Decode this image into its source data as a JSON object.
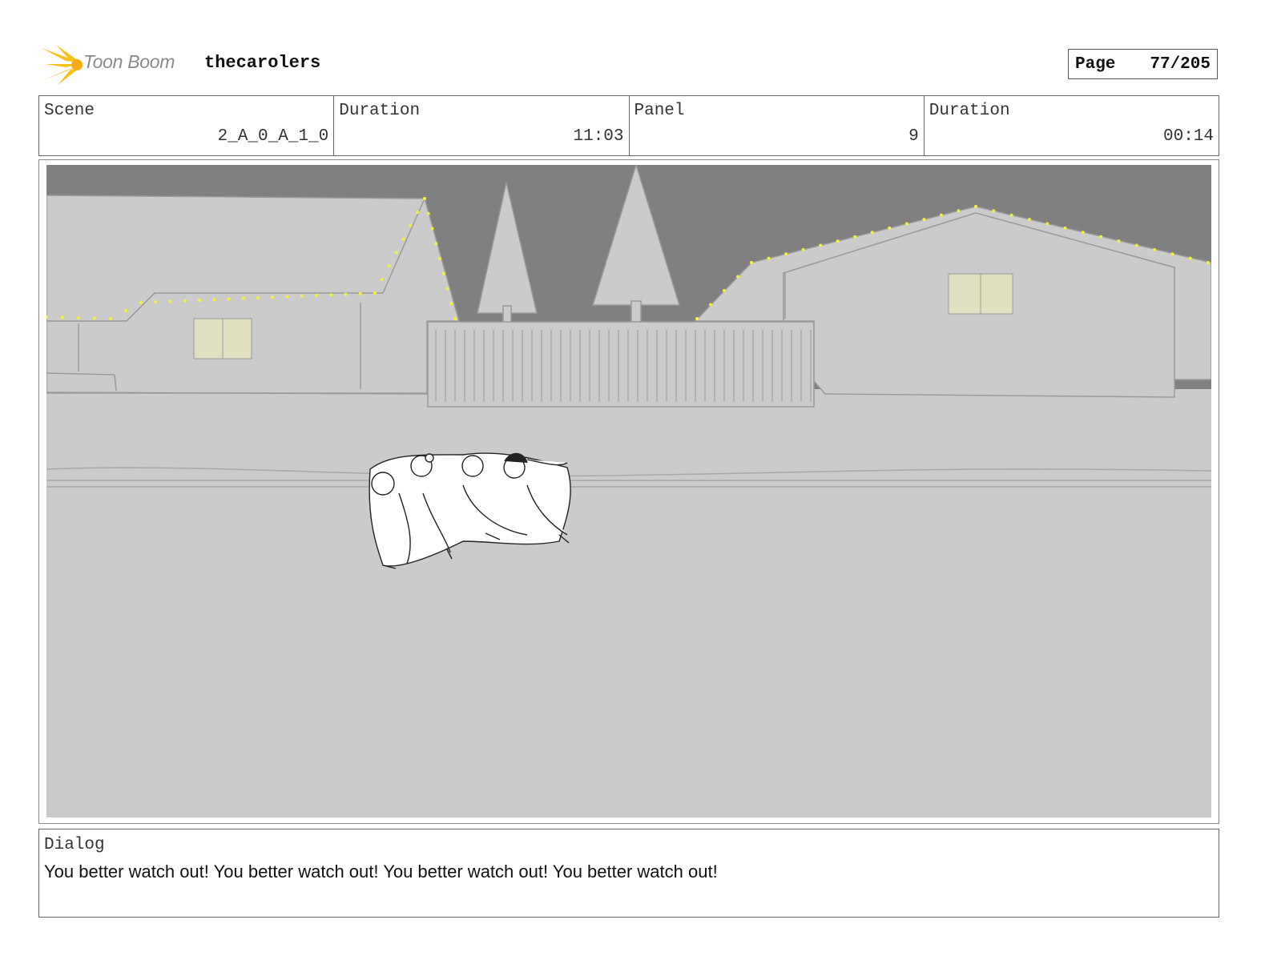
{
  "header": {
    "logo_text": "Toon Boom",
    "project_name": "thecarolers",
    "page_label": "Page",
    "page_number": "77/205"
  },
  "info": {
    "scene_label": "Scene",
    "scene_value": "2_A_0_A_1_0",
    "scene_duration_label": "Duration",
    "scene_duration_value": "11:03",
    "panel_label": "Panel",
    "panel_value": "9",
    "panel_duration_label": "Duration",
    "panel_duration_value": "00:14"
  },
  "panel": {
    "icons": [
      "logo-star-icon"
    ],
    "colors": {
      "sky": "#808080",
      "ground": "#cbcbcb",
      "lights": "#f2f23a",
      "window": "#e0e0c0"
    }
  },
  "dialog": {
    "label": "Dialog",
    "text": "You better watch out! You better watch out! You better watch out! You better watch out!"
  }
}
